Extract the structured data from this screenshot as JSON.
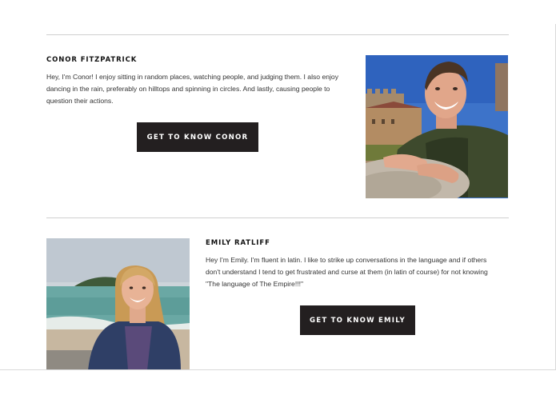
{
  "profiles": [
    {
      "name": "CONOR FITZPATRICK",
      "bio_lines": [
        "Hey, I'm Conor! I enjoy sitting in random places, watching people, and judging them. I also enjoy",
        "dancing in the rain, preferably on hilltops and spinning in circles. And lastly, causing people to",
        "question their actions."
      ],
      "button_label": "GET TO KNOW CONOR"
    },
    {
      "name": "EMILY RATLIFF",
      "bio_lines": [
        "Hey I'm Emily. I'm fluent in latin. I like to strike up conversations in the language and if others",
        "don't understand I tend to get frustrated and curse at them (in latin of course) for not knowing",
        "\"The language of The Empire!!!\""
      ],
      "button_label": "GET TO KNOW EMILY"
    }
  ]
}
